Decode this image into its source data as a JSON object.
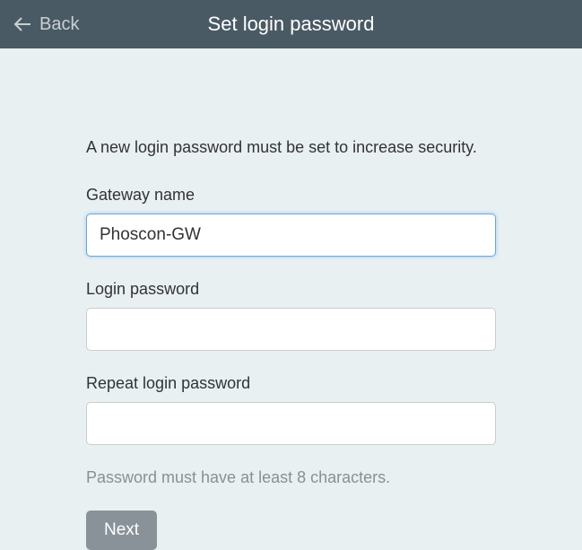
{
  "header": {
    "back_label": "Back",
    "title": "Set login password"
  },
  "form": {
    "intro": "A new login password must be set to increase security.",
    "gateway_name": {
      "label": "Gateway name",
      "value": "Phoscon-GW"
    },
    "login_password": {
      "label": "Login password",
      "value": ""
    },
    "repeat_password": {
      "label": "Repeat login password",
      "value": ""
    },
    "hint": "Password must have at least 8 characters.",
    "next_label": "Next"
  }
}
